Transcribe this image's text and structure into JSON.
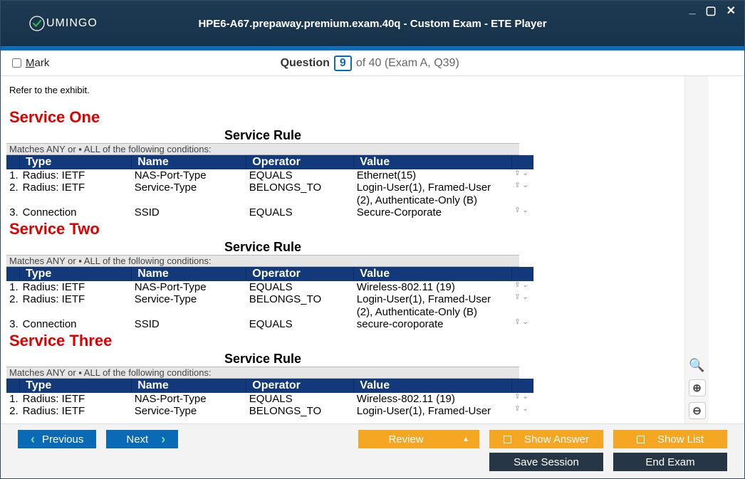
{
  "window": {
    "title": "HPE6-A67.prepaway.premium.exam.40q - Custom Exam - ETE Player",
    "logo_text": "UMINGO"
  },
  "topbar": {
    "mark_label": "Mark",
    "question_label": "Question",
    "question_number": "9",
    "of_text": "of 40 (Exam A, Q39)"
  },
  "content": {
    "refer_text": "Refer to the exhibit.",
    "matches_text": "Matches   ANY or  ▪ ALL  of the following conditions:",
    "service_rule_label": "Service Rule",
    "headers": {
      "type": "Type",
      "name": "Name",
      "operator": "Operator",
      "value": "Value"
    },
    "services": [
      {
        "title": "Service One",
        "rows": [
          {
            "n": "1.",
            "type": "Radius: IETF",
            "name": "NAS-Port-Type",
            "op": "EQUALS",
            "val": "Ethernet(15)"
          },
          {
            "n": "2.",
            "type": "Radius: IETF",
            "name": "Service-Type",
            "op": "BELONGS_TO",
            "val": "Login-User(1), Framed-User (2), Authenticate-Only (B)"
          },
          {
            "n": "3.",
            "type": "Connection",
            "name": "SSID",
            "op": "EQUALS",
            "val": "Secure-Corporate"
          }
        ]
      },
      {
        "title": "Service Two",
        "rows": [
          {
            "n": "1.",
            "type": "Radius: IETF",
            "name": "NAS-Port-Type",
            "op": "EQUALS",
            "val": "Wireless-802.11 (19)"
          },
          {
            "n": "2.",
            "type": "Radius: IETF",
            "name": "Service-Type",
            "op": "BELONGS_TO",
            "val": "Login-User(1), Framed-User (2), Authenticate-Only (B)"
          },
          {
            "n": "3.",
            "type": "Connection",
            "name": "SSID",
            "op": "EQUALS",
            "val": "secure-coroporate"
          }
        ]
      },
      {
        "title": "Service Three",
        "rows": [
          {
            "n": "1.",
            "type": "Radius: IETF",
            "name": "NAS-Port-Type",
            "op": "EQUALS",
            "val": "Wireless-802.11 (19)"
          },
          {
            "n": "2.",
            "type": "Radius: IETF",
            "name": "Service-Type",
            "op": "BELONGS_TO",
            "val": "Login-User(1), Framed-User"
          }
        ]
      }
    ]
  },
  "footer": {
    "previous": "Previous",
    "next": "Next",
    "review": "Review",
    "show_answer": "Show Answer",
    "show_list": "Show List",
    "save_session": "Save Session",
    "end_exam": "End Exam"
  }
}
